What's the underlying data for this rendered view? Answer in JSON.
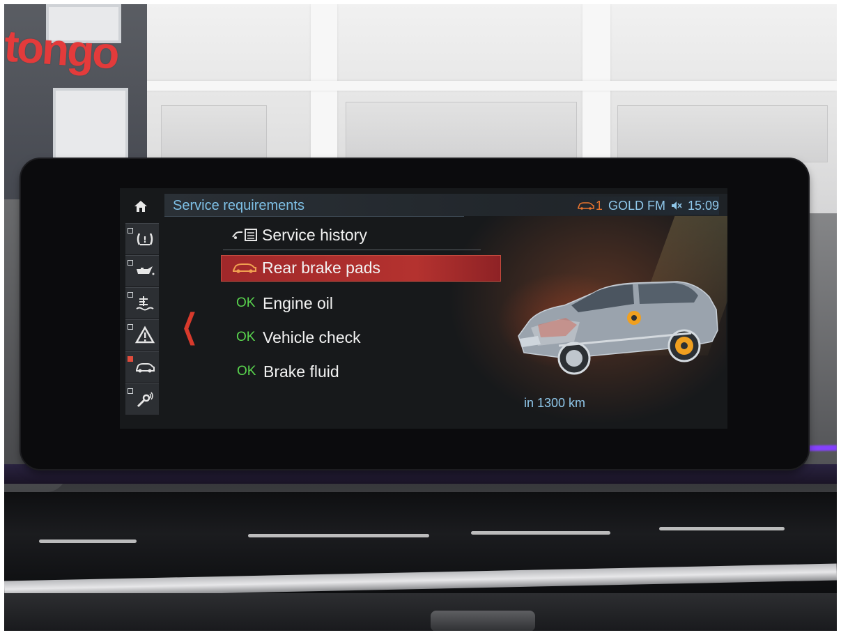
{
  "background": {
    "sign_text": "tongo"
  },
  "screen": {
    "header": {
      "title": "Service requirements",
      "status": {
        "car_count": "1",
        "radio": "GOLD FM",
        "time": "15:09"
      }
    },
    "sidebar": {
      "items": [
        {
          "icon": "home-icon"
        },
        {
          "icon": "tire-pressure-icon"
        },
        {
          "icon": "oil-can-icon"
        },
        {
          "icon": "coolant-level-icon"
        },
        {
          "icon": "warning-triangle-icon"
        },
        {
          "icon": "car-status-icon",
          "active": true
        },
        {
          "icon": "wrench-service-icon"
        }
      ]
    },
    "list": {
      "items": [
        {
          "status": "",
          "label": "Service history",
          "icon": "service-history-icon"
        },
        {
          "status": "",
          "label": "Rear brake pads",
          "icon": "car-icon",
          "selected": true
        },
        {
          "status": "OK",
          "label": "Engine oil"
        },
        {
          "status": "OK",
          "label": "Vehicle check"
        },
        {
          "status": "OK",
          "label": "Brake fluid"
        }
      ]
    },
    "detail": {
      "due": "in 1300 km"
    },
    "colors": {
      "accent_blue": "#7ec0e6",
      "selection_red": "#b4322f",
      "ok_green": "#59d44e",
      "warning_orange": "#e8742e"
    }
  }
}
